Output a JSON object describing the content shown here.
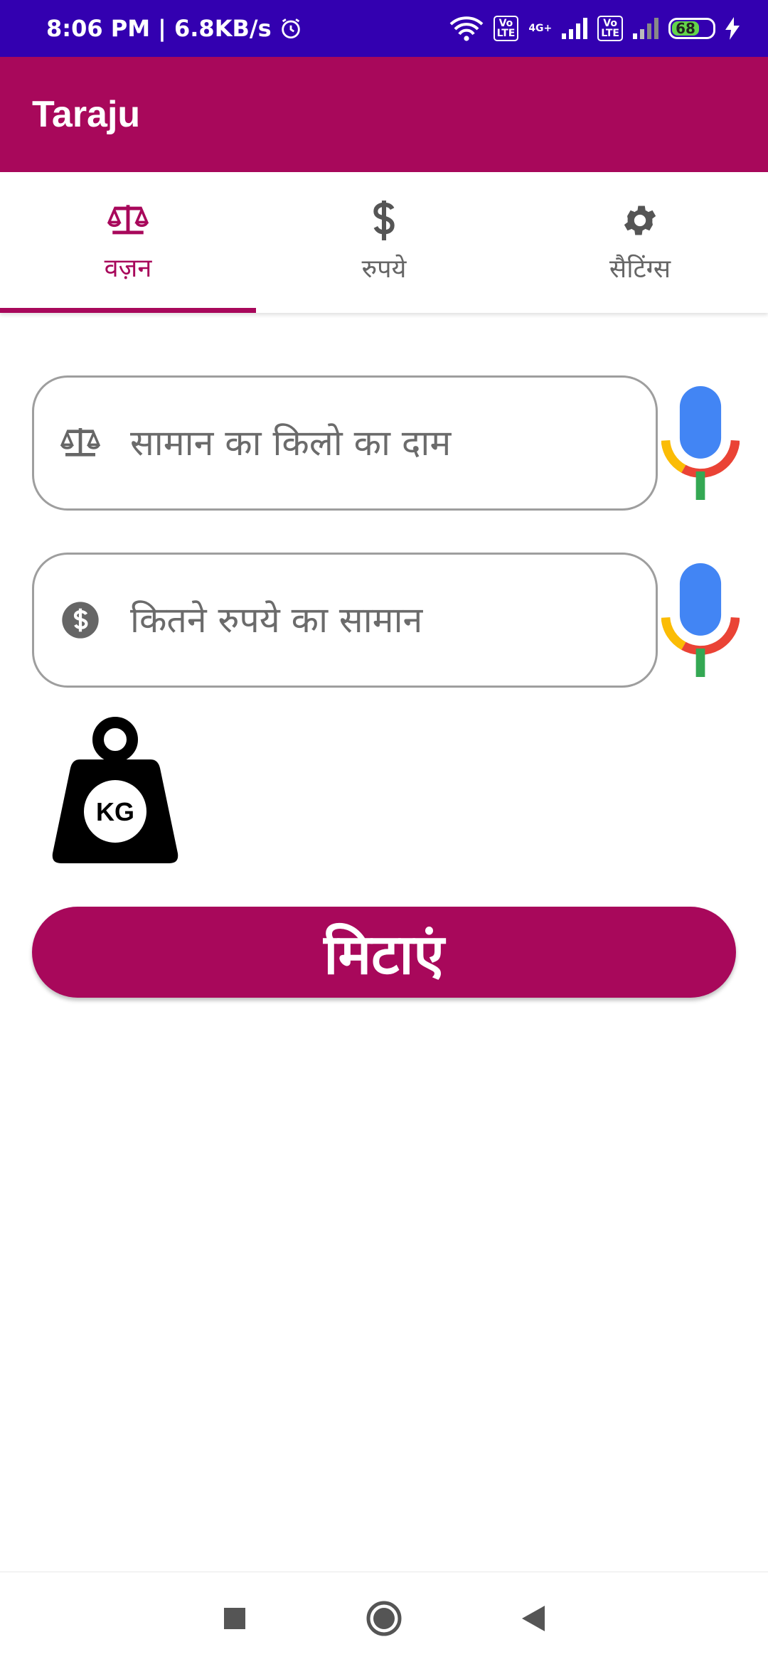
{
  "status_bar": {
    "time_speed": "8:06 PM | 6.8KB/s",
    "lte1": "Vo\nLTE",
    "net": "4G+",
    "lte2": "Vo\nLTE",
    "battery": "68"
  },
  "app": {
    "title": "Taraju"
  },
  "tabs": [
    {
      "label": "वज़न",
      "icon": "scale-icon",
      "active": true
    },
    {
      "label": "रुपये",
      "icon": "dollar-icon",
      "active": false
    },
    {
      "label": "सैटिंग्स",
      "icon": "gear-icon",
      "active": false
    }
  ],
  "fields": {
    "price_per_kg": {
      "placeholder": "सामान का किलो का दाम",
      "value": ""
    },
    "amount": {
      "placeholder": "कितने रुपये का सामान",
      "value": ""
    }
  },
  "weight_label": "KG",
  "clear_button": {
    "label": "मिटाएं"
  },
  "colors": {
    "primary": "#a8085b",
    "status_bar": "#3300b0",
    "mic_blue": "#4285f4",
    "mic_red": "#ea4335",
    "mic_yellow": "#fbbc05",
    "mic_green": "#34a853"
  }
}
